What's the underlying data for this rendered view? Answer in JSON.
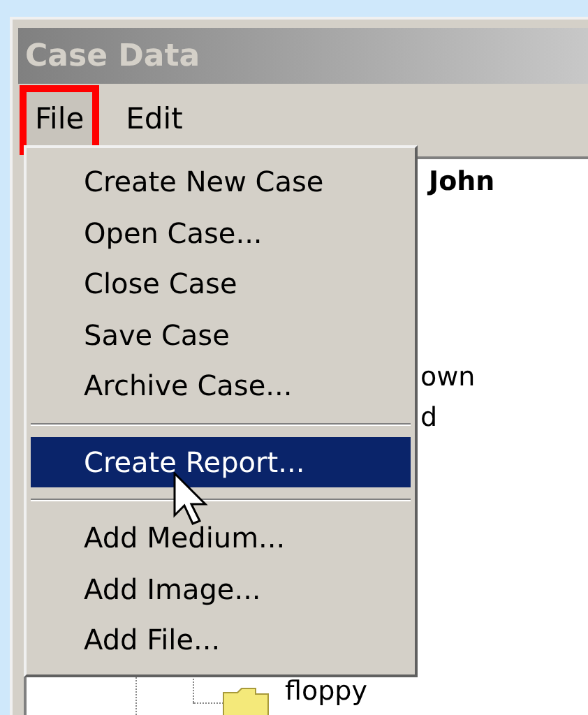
{
  "window": {
    "title": "Case Data"
  },
  "menubar": [
    {
      "label": "File",
      "selected": true,
      "annotated": true
    },
    {
      "label": "Edit",
      "selected": false,
      "annotated": false
    }
  ],
  "file_menu": [
    {
      "kind": "item",
      "label": "Create New Case",
      "selected": false
    },
    {
      "kind": "item",
      "label": "Open Case...",
      "selected": false
    },
    {
      "kind": "item",
      "label": "Close Case",
      "selected": false
    },
    {
      "kind": "item",
      "label": "Save Case",
      "selected": false
    },
    {
      "kind": "item",
      "label": "Archive Case...",
      "selected": false
    },
    {
      "kind": "separator"
    },
    {
      "kind": "item",
      "label": "Create Report...",
      "selected": true
    },
    {
      "kind": "separator"
    },
    {
      "kind": "item",
      "label": "Add Medium...",
      "selected": false
    },
    {
      "kind": "item",
      "label": "Add Image...",
      "selected": false
    },
    {
      "kind": "item",
      "label": "Add File...",
      "selected": false
    }
  ],
  "details": {
    "name": "John",
    "line_1": "own",
    "line_2": "d"
  },
  "tree": {
    "item": "floppy"
  }
}
